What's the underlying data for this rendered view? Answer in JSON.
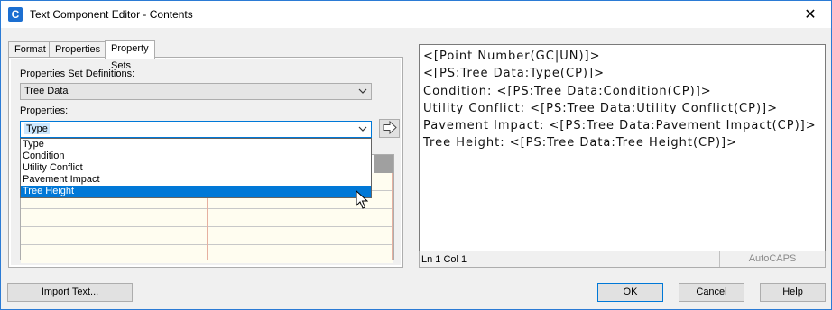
{
  "window": {
    "title": "Text Component Editor - Contents",
    "app_icon": "C",
    "close_glyph": "✕"
  },
  "tabs": [
    {
      "label": "Format",
      "active": false
    },
    {
      "label": "Properties",
      "active": false
    },
    {
      "label": "Property Sets",
      "active": true
    }
  ],
  "form": {
    "psd_label": "Properties Set Definitions:",
    "psd_value": "Tree Data",
    "properties_label": "Properties:",
    "properties_value": "Type",
    "insert_button_glyph": "⇨"
  },
  "dropdown_options": [
    {
      "label": "Type",
      "highlighted": false
    },
    {
      "label": "Condition",
      "highlighted": false
    },
    {
      "label": "Utility Conflict",
      "highlighted": false
    },
    {
      "label": "Pavement Impact",
      "highlighted": false
    },
    {
      "label": "Tree Height",
      "highlighted": true
    }
  ],
  "editor": {
    "lines": [
      "<[Point Number(GC|UN)]>",
      "<[PS:Tree Data:Type(CP)]>",
      "Condition: <[PS:Tree Data:Condition(CP)]>",
      "Utility Conflict: <[PS:Tree Data:Utility Conflict(CP)]>",
      "Pavement Impact: <[PS:Tree Data:Pavement Impact(CP)]>",
      "Tree Height: <[PS:Tree Data:Tree Height(CP)]>"
    ],
    "status_position": "Ln 1 Col 1",
    "status_caps": "AutoCAPS"
  },
  "buttons": {
    "import": "Import Text...",
    "ok": "OK",
    "cancel": "Cancel",
    "help": "Help"
  },
  "colors": {
    "accent": "#0078d7",
    "title_border": "#2b7bd5"
  }
}
